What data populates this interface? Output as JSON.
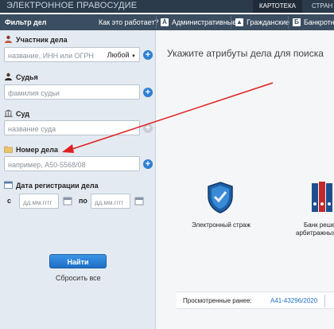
{
  "header": {
    "brand": "ЭЛЕКТРОННОЕ ПРАВОСУДИЕ",
    "tabs": [
      {
        "label": "КАРТОТЕКА"
      },
      {
        "label": "СТРАН"
      }
    ]
  },
  "subbar": {
    "filter_title": "Фильтр дел",
    "how_link": "Как это работает?",
    "categories": [
      {
        "icon": "a-icon",
        "label": "Административные"
      },
      {
        "icon": "person-icon",
        "label": "Гражданские"
      },
      {
        "icon": "b-icon",
        "label": "Банкротн"
      }
    ]
  },
  "filters": {
    "participant": {
      "label": "Участник дела",
      "placeholder": "название, ИНН или ОГРН",
      "role": "Любой"
    },
    "judge": {
      "label": "Судья",
      "placeholder": "фамилия судьи"
    },
    "court": {
      "label": "Суд",
      "placeholder": "название суда"
    },
    "case_number": {
      "label": "Номер дела",
      "placeholder": "например, А50-5568/08"
    },
    "registration_date": {
      "label": "Дата регистрации дела",
      "from_label": "с",
      "from_placeholder": "дд.мм.гггг",
      "to_label": "по",
      "to_placeholder": "дд.мм.гггг"
    },
    "find_button": "Найти",
    "reset_link": "Сбросить все"
  },
  "main": {
    "hint": "Укажите атрибуты дела для поиска",
    "tiles": [
      {
        "icon": "shield-icon",
        "label": "Электронный страж"
      },
      {
        "icon": "binders-icon",
        "label": "Банк реше",
        "label2": "арбитражных"
      }
    ],
    "viewed": {
      "label": "Просмотренные ранее:",
      "link": "А41-43296/2020"
    }
  },
  "colors": {
    "header": "#2c3b4c",
    "subbar": "#3b4d60",
    "accent": "#2f7fd2",
    "annotation_arrow": "#e02020"
  }
}
